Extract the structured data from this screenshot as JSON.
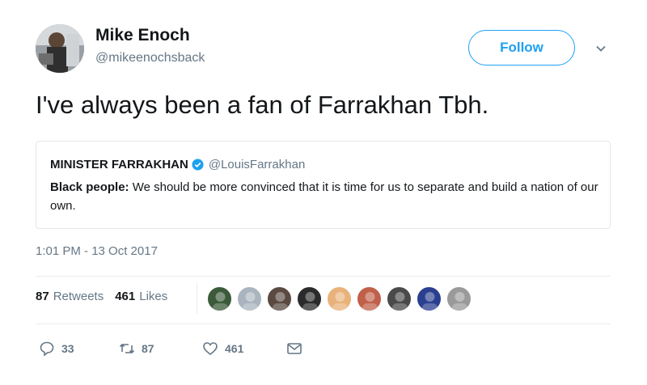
{
  "author": {
    "name": "Mike Enoch",
    "handle": "@mikeenochsback"
  },
  "follow_button": {
    "label": "Follow"
  },
  "tweet": {
    "text": "I've always been a fan of Farrakhan Tbh."
  },
  "quoted_tweet": {
    "author_name": "MINISTER FARRAKHAN",
    "author_handle": "@LouisFarrakhan",
    "text_bold": "Black people:",
    "text_rest": " We should be more convinced that it is time for us to separate and build a nation of our own."
  },
  "timestamp": "1:01 PM - 13 Oct 2017",
  "stats": {
    "retweets_count": "87",
    "retweets_label": "Retweets",
    "likes_count": "461",
    "likes_label": "Likes"
  },
  "likers": [
    {
      "color": "#3b5a3a"
    },
    {
      "color": "#aab4be"
    },
    {
      "color": "#5a4a42"
    },
    {
      "color": "#2b2b2b"
    },
    {
      "color": "#e8b27a"
    },
    {
      "color": "#c0604a"
    },
    {
      "color": "#4a4a4a"
    },
    {
      "color": "#2a3f8f"
    },
    {
      "color": "#9a9a9a"
    }
  ],
  "actions": {
    "reply_count": "33",
    "retweet_count": "87",
    "like_count": "461"
  },
  "colors": {
    "accent": "#1da1f2",
    "muted": "#657786"
  }
}
